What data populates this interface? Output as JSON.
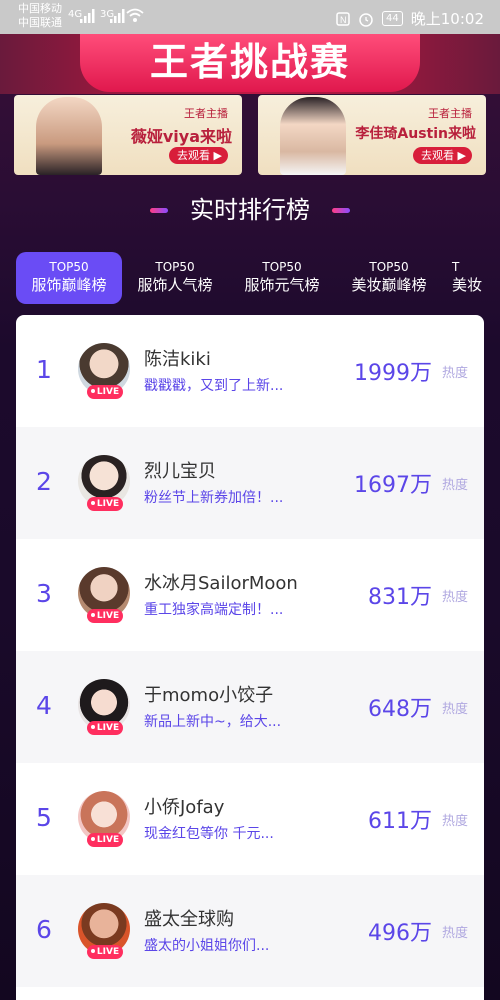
{
  "status_bar": {
    "carrier1": "中国移动",
    "carrier2": "中国联通",
    "net1": "4G",
    "net2": "3G",
    "battery": "44",
    "time": "晚上10:02"
  },
  "banner": {
    "title": "王者挑战赛",
    "promos": [
      {
        "subtitle": "王者主播",
        "name": "薇娅viya来啦",
        "button": "去观看"
      },
      {
        "subtitle": "王者主播",
        "name": "李佳琦Austin来啦",
        "button": "去观看"
      }
    ]
  },
  "section_title": "实时排行榜",
  "tabs": [
    {
      "top": "TOP50",
      "label": "服饰巅峰榜"
    },
    {
      "top": "TOP50",
      "label": "服饰人气榜"
    },
    {
      "top": "TOP50",
      "label": "服饰元气榜"
    },
    {
      "top": "TOP50",
      "label": "美妆巅峰榜"
    },
    {
      "top": "T",
      "label": "美妆"
    }
  ],
  "ranking": [
    {
      "rank": "1",
      "name": "陈洁kiki",
      "desc": "戳戳戳，又到了上新...",
      "heat": "1999万",
      "heat_label": "热度",
      "live": "LIVE"
    },
    {
      "rank": "2",
      "name": "烈儿宝贝",
      "desc": "粉丝节上新券加倍！...",
      "heat": "1697万",
      "heat_label": "热度",
      "live": "LIVE"
    },
    {
      "rank": "3",
      "name": "水冰月SailorMoon",
      "desc": "重工独家高端定制！...",
      "heat": "831万",
      "heat_label": "热度",
      "live": "LIVE"
    },
    {
      "rank": "4",
      "name": "于momo小饺子",
      "desc": "新品上新中~，给大...",
      "heat": "648万",
      "heat_label": "热度",
      "live": "LIVE"
    },
    {
      "rank": "5",
      "name": "小侨Jofay",
      "desc": "现金红包等你 千元...",
      "heat": "611万",
      "heat_label": "热度",
      "live": "LIVE"
    },
    {
      "rank": "6",
      "name": "盛太全球购",
      "desc": "盛太的小姐姐你们...",
      "heat": "496万",
      "heat_label": "热度",
      "live": "LIVE"
    }
  ]
}
